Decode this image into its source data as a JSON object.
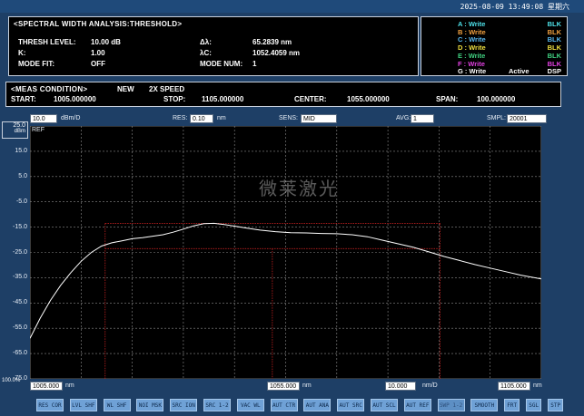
{
  "clock": "2025-08-09 13:49:08 星期六",
  "analysis": {
    "title": "<SPECTRAL WIDTH ANALYSIS:THRESHOLD>",
    "rows": [
      {
        "label": "THRESH LEVEL:",
        "value": "10.00 dB",
        "label2": "Δλ:",
        "value2": "65.2839 nm"
      },
      {
        "label": "K:",
        "value": "1.00",
        "label2": "λC:",
        "value2": "1052.4059 nm"
      },
      {
        "label": "MODE FIT:",
        "value": "OFF",
        "label2": "MODE NUM:",
        "value2": "1"
      }
    ]
  },
  "traces": [
    {
      "name": "A",
      "mode": "Write",
      "state": "BLK",
      "color": "#4ee0e8"
    },
    {
      "name": "B",
      "mode": "Write",
      "state": "BLK",
      "color": "#f0a040"
    },
    {
      "name": "C",
      "mode": "Write",
      "state": "BLK",
      "color": "#58b8f0"
    },
    {
      "name": "D",
      "mode": "Write",
      "state": "BLK",
      "color": "#f0e040"
    },
    {
      "name": "E",
      "mode": "Write",
      "state": "BLK",
      "color": "#40d080"
    },
    {
      "name": "F",
      "mode": "Write",
      "state": "BLK",
      "color": "#e040e0"
    },
    {
      "name": "G",
      "mode": "Write",
      "state": "DSP",
      "color": "#ffffff",
      "extra": "Active"
    }
  ],
  "meas": {
    "title": "<MEAS CONDITION>",
    "mode": "NEW",
    "speed": "2X SPEED",
    "start_label": "START:",
    "start": "1005.000000",
    "stop_label": "STOP:",
    "stop": "1105.000000",
    "center_label": "CENTER:",
    "center": "1055.000000",
    "span_label": "SPAN:",
    "span": "100.000000"
  },
  "params": {
    "scale_value": "10.0",
    "scale_unit": "dBm/D",
    "res_label": "RES:",
    "res_value": "0.10",
    "res_unit": "nm",
    "sens_label": "SENS:",
    "sens_value": "MID",
    "avg_label": "AVG:",
    "avg_value": "1",
    "smpl_label": "SMPL:",
    "smpl_value": "20001"
  },
  "y_axis": {
    "ref_value": "25.0",
    "ref_unit": "dBm",
    "ref_label": "REF",
    "ticks": [
      "15.0",
      "5.0",
      "-5.0",
      "-15.0",
      "-25.0",
      "-35.0",
      "-45.0",
      "-55.0",
      "-65.0",
      "-75.0"
    ],
    "bottom_label": "100.0%"
  },
  "x_axis": {
    "start": "1005.000",
    "center": "1055.000",
    "div": "10.000",
    "stop": "1105.000",
    "unit": "nm",
    "div_unit": "nm/D"
  },
  "chart_data": {
    "type": "line",
    "xlim": [
      1005,
      1105
    ],
    "ylim": [
      -75,
      25
    ],
    "series": [
      {
        "color": "#ffffff",
        "x": [
          1005,
          1007,
          1009,
          1011,
          1013,
          1015,
          1017,
          1019,
          1021,
          1023,
          1025,
          1027,
          1029,
          1031,
          1033,
          1035,
          1037,
          1039,
          1041,
          1043,
          1045,
          1047,
          1050,
          1053,
          1056,
          1059,
          1062,
          1065,
          1068,
          1071,
          1074,
          1077,
          1080,
          1083,
          1086,
          1089,
          1092,
          1095,
          1098,
          1101,
          1105
        ],
        "y": [
          -59,
          -51,
          -44,
          -38,
          -33,
          -28.5,
          -25,
          -22.5,
          -21.2,
          -20.4,
          -19.6,
          -19.2,
          -18.6,
          -18,
          -17,
          -15.8,
          -14.5,
          -13.6,
          -13.5,
          -14,
          -14.6,
          -15.3,
          -16.2,
          -16.8,
          -17.2,
          -17.3,
          -17.5,
          -17.6,
          -18,
          -18.8,
          -20.2,
          -21.6,
          -23,
          -24.8,
          -26.6,
          -28.2,
          -29.8,
          -31.2,
          -32.6,
          -34,
          -35.5
        ]
      }
    ],
    "markers": {
      "color": "#c02020",
      "outer": {
        "x1": 1019.7,
        "x2": 1085.2,
        "level": -13.5
      },
      "inner": {
        "x1": 1019.7,
        "x2": 1085.2,
        "level": -23.5
      },
      "center_x": 1052.4,
      "inner_box": {
        "x1": 1052.4,
        "x2": 1085.2,
        "level": -23.5
      }
    }
  },
  "watermark": "微莱激光",
  "softkeys": [
    {
      "label": "RES COR",
      "dim": false
    },
    {
      "label": "LVL SHF",
      "dim": false
    },
    {
      "label": "WL SHF",
      "dim": false
    },
    {
      "label": "NOI MSK",
      "dim": false
    },
    {
      "label": "SRC ION",
      "dim": false
    },
    {
      "label": "SRC 1-2",
      "dim": false
    },
    {
      "label": "VAC WL",
      "dim": false
    },
    {
      "label": "AUT CTR",
      "dim": false
    },
    {
      "label": "AUT ANA",
      "dim": false
    },
    {
      "label": "AUT SRC",
      "dim": false
    },
    {
      "label": "AUT SCL",
      "dim": false
    },
    {
      "label": "AUT REF",
      "dim": false
    },
    {
      "label": "SWP 1-2",
      "dim": true
    },
    {
      "label": "SMOOTH",
      "dim": false
    },
    {
      "label": "FRT",
      "dim": false
    },
    {
      "label": "SGL",
      "dim": false
    },
    {
      "label": "STP",
      "dim": false
    }
  ]
}
